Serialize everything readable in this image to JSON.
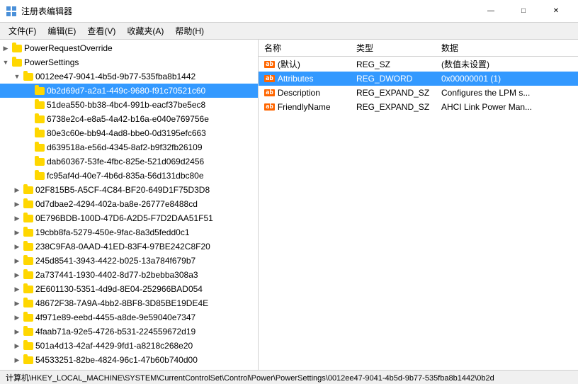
{
  "titleBar": {
    "icon": "🗂",
    "title": "注册表编辑器",
    "minimizeLabel": "—",
    "maximizeLabel": "□",
    "closeLabel": "✕"
  },
  "menuBar": {
    "items": [
      {
        "label": "文件(F)"
      },
      {
        "label": "编辑(E)"
      },
      {
        "label": "查看(V)"
      },
      {
        "label": "收藏夹(A)"
      },
      {
        "label": "帮助(H)"
      }
    ]
  },
  "treeNodes": [
    {
      "id": "n0",
      "level": 0,
      "expanded": false,
      "label": "PowerRequestOverride",
      "selected": false
    },
    {
      "id": "n1",
      "level": 0,
      "expanded": true,
      "label": "PowerSettings",
      "selected": false
    },
    {
      "id": "n2",
      "level": 1,
      "expanded": true,
      "label": "0012ee47-9041-4b5d-9b77-535fba8b1442",
      "selected": false
    },
    {
      "id": "n3",
      "level": 2,
      "expanded": false,
      "label": "0b2d69d7-a2a1-449c-9680-f91c70521c60",
      "selected": true
    },
    {
      "id": "n4",
      "level": 2,
      "expanded": false,
      "label": "51dea550-bb38-4bc4-991b-eacf37be5ec8",
      "selected": false
    },
    {
      "id": "n5",
      "level": 2,
      "expanded": false,
      "label": "6738e2c4-e8a5-4a42-b16a-e040e769756e",
      "selected": false
    },
    {
      "id": "n6",
      "level": 2,
      "expanded": false,
      "label": "80e3c60e-bb94-4ad8-bbe0-0d3195efc663",
      "selected": false
    },
    {
      "id": "n7",
      "level": 2,
      "expanded": false,
      "label": "d639518a-e56d-4345-8af2-b9f32fb26109",
      "selected": false
    },
    {
      "id": "n8",
      "level": 2,
      "expanded": false,
      "label": "dab60367-53fe-4fbc-825e-521d069d2456",
      "selected": false
    },
    {
      "id": "n9",
      "level": 2,
      "expanded": false,
      "label": "fc95af4d-40e7-4b6d-835a-56d131dbc80e",
      "selected": false
    },
    {
      "id": "n10",
      "level": 1,
      "expanded": false,
      "label": "02F815B5-A5CF-4C84-BF20-649D1F75D3D8",
      "selected": false
    },
    {
      "id": "n11",
      "level": 1,
      "expanded": false,
      "label": "0d7dbae2-4294-402a-ba8e-26777e8488cd",
      "selected": false
    },
    {
      "id": "n12",
      "level": 1,
      "expanded": false,
      "label": "0E796BDB-100D-47D6-A2D5-F7D2DAA51F51",
      "selected": false
    },
    {
      "id": "n13",
      "level": 1,
      "expanded": false,
      "label": "19cbb8fa-5279-450e-9fac-8a3d5fedd0c1",
      "selected": false
    },
    {
      "id": "n14",
      "level": 1,
      "expanded": false,
      "label": "238C9FA8-0AAD-41ED-83F4-97BE242C8F20",
      "selected": false
    },
    {
      "id": "n15",
      "level": 1,
      "expanded": false,
      "label": "245d8541-3943-4422-b025-13a784f679b7",
      "selected": false
    },
    {
      "id": "n16",
      "level": 1,
      "expanded": false,
      "label": "2a737441-1930-4402-8d77-b2bebba308a3",
      "selected": false
    },
    {
      "id": "n17",
      "level": 1,
      "expanded": false,
      "label": "2E601130-5351-4d9d-8E04-252966BAD054",
      "selected": false
    },
    {
      "id": "n18",
      "level": 1,
      "expanded": false,
      "label": "48672F38-7A9A-4bb2-8BF8-3D85BE19DE4E",
      "selected": false
    },
    {
      "id": "n19",
      "level": 1,
      "expanded": false,
      "label": "4f971e89-eebd-4455-a8de-9e59040e7347",
      "selected": false
    },
    {
      "id": "n20",
      "level": 1,
      "expanded": false,
      "label": "4faab71a-92e5-4726-b531-224559672d19",
      "selected": false
    },
    {
      "id": "n21",
      "level": 1,
      "expanded": false,
      "label": "501a4d13-42af-4429-9fd1-a8218c268e20",
      "selected": false
    },
    {
      "id": "n22",
      "level": 1,
      "expanded": false,
      "label": "54533251-82be-4824-96c1-47b60b740d00",
      "selected": false
    }
  ],
  "detailTable": {
    "columns": [
      {
        "label": "名称",
        "key": "name"
      },
      {
        "label": "类型",
        "key": "type"
      },
      {
        "label": "数据",
        "key": "data"
      }
    ],
    "rows": [
      {
        "name": "(默认)",
        "type": "REG_SZ",
        "data": "(数值未设置)",
        "icon": "ab"
      },
      {
        "name": "Attributes",
        "type": "REG_DWORD",
        "data": "0x00000001 (1)",
        "icon": "ab"
      },
      {
        "name": "Description",
        "type": "REG_EXPAND_SZ",
        "data": "Configures the LPM s...",
        "icon": "ab"
      },
      {
        "name": "FriendlyName",
        "type": "REG_EXPAND_SZ",
        "data": "AHCI Link Power Man...",
        "icon": "ab"
      }
    ]
  },
  "statusBar": {
    "text": "计算机\\HKEY_LOCAL_MACHINE\\SYSTEM\\CurrentControlSet\\Control\\Power\\PowerSettings\\0012ee47-9041-4b5d-9b77-535fba8b1442\\0b2d"
  }
}
